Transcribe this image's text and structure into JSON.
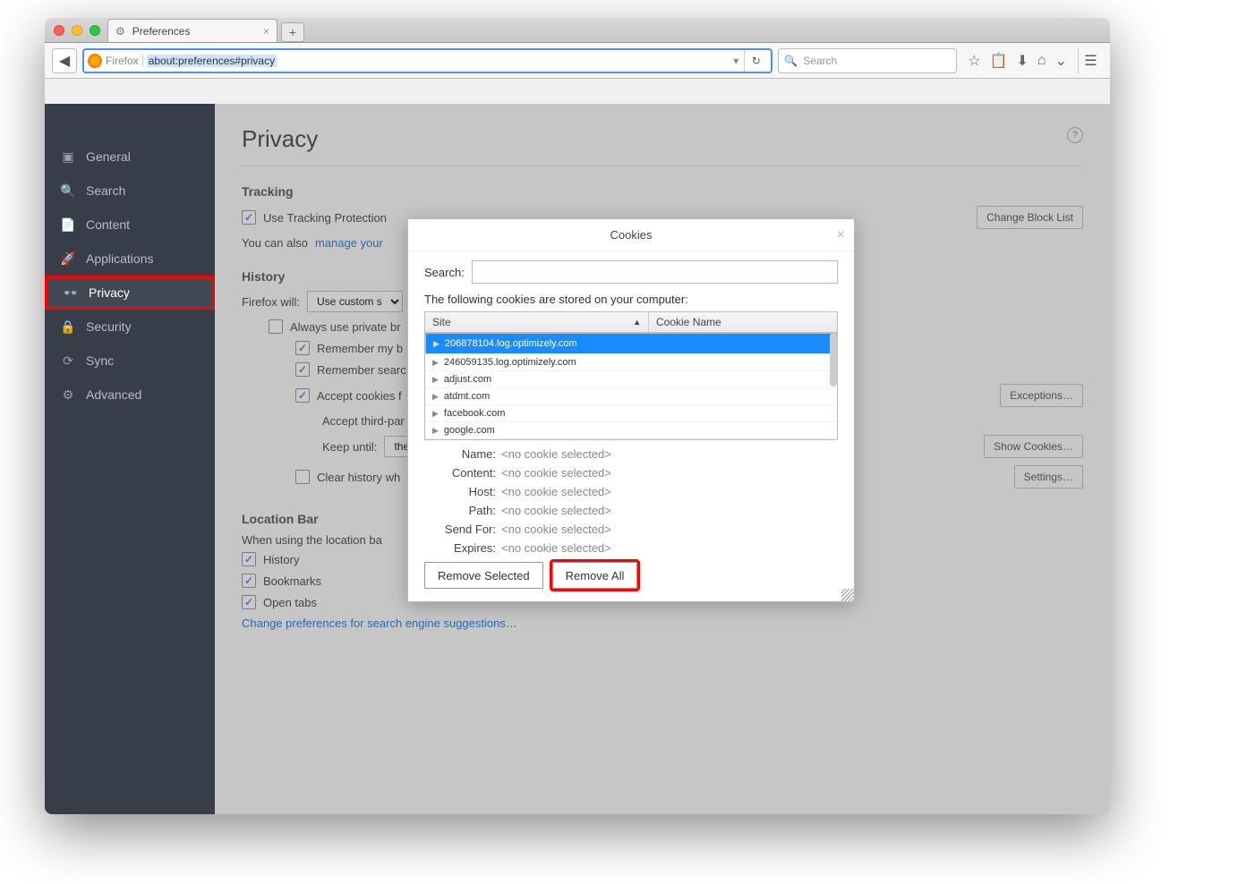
{
  "window": {
    "tab_title": "Preferences",
    "url_identity": "Firefox",
    "url": "about:preferences#privacy",
    "search_placeholder": "Search"
  },
  "sidebar": {
    "items": [
      {
        "icon": "▣",
        "label": "General"
      },
      {
        "icon": "🔍",
        "label": "Search"
      },
      {
        "icon": "📄",
        "label": "Content"
      },
      {
        "icon": "🚀",
        "label": "Applications"
      },
      {
        "icon": "👓",
        "label": "Privacy"
      },
      {
        "icon": "🔒",
        "label": "Security"
      },
      {
        "icon": "⟳",
        "label": "Sync"
      },
      {
        "icon": "⚙",
        "label": "Advanced"
      }
    ],
    "active_index": 4
  },
  "page": {
    "title": "Privacy",
    "tracking": {
      "heading": "Tracking",
      "cb_label": "Use Tracking Protection",
      "btn_blocklist": "Change Block List",
      "manage_prefix": "You can also ",
      "manage_link": "manage your"
    },
    "history": {
      "heading": "History",
      "fw_label": "Firefox will:",
      "fw_value": "Use custom s",
      "cb_private": "Always use private br",
      "cb_remember_browse": "Remember my b",
      "cb_remember_search": "Remember searc",
      "cb_accept_cookies": "Accept cookies f",
      "lbl_third": "Accept third-par",
      "lbl_keep": "Keep until:",
      "keep_value": "they",
      "cb_clear": "Clear history wh",
      "btn_exceptions": "Exceptions…",
      "btn_show_cookies": "Show Cookies…",
      "btn_settings": "Settings…"
    },
    "location": {
      "heading": "Location Bar",
      "desc": "When using the location ba",
      "cb_history": "History",
      "cb_bookmarks": "Bookmarks",
      "cb_opentabs": "Open tabs",
      "link": "Change preferences for search engine suggestions…"
    }
  },
  "dialog": {
    "title": "Cookies",
    "search_label": "Search:",
    "desc": "The following cookies are stored on your computer:",
    "col_site": "Site",
    "col_name": "Cookie Name",
    "rows": [
      {
        "site": "206878104.log.optimizely.com",
        "selected": true
      },
      {
        "site": "246059135.log.optimizely.com"
      },
      {
        "site": "adjust.com"
      },
      {
        "site": "atdmt.com"
      },
      {
        "site": "facebook.com"
      },
      {
        "site": "google.com"
      }
    ],
    "fields": {
      "name_lbl": "Name:",
      "content_lbl": "Content:",
      "host_lbl": "Host:",
      "path_lbl": "Path:",
      "sendfor_lbl": "Send For:",
      "expires_lbl": "Expires:",
      "placeholder": "<no cookie selected>"
    },
    "btn_remove_selected": "Remove Selected",
    "btn_remove_all": "Remove All"
  }
}
